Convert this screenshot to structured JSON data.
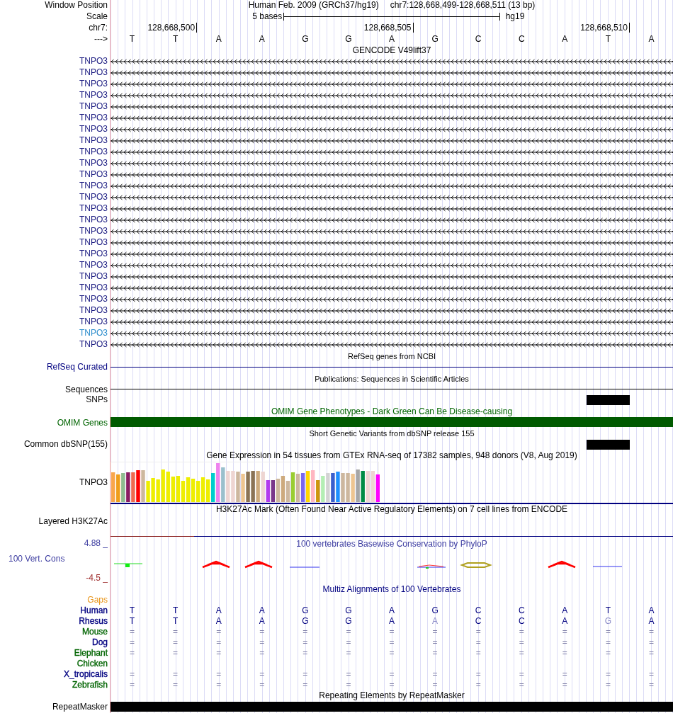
{
  "window_position": {
    "label": "Window Position",
    "assembly": "Human Feb. 2009 (GRCh37/hg19)",
    "range": "chr7:128,668,499-128,668,511 (13 bp)"
  },
  "scale": {
    "label": "Scale",
    "bar_text": "5 bases",
    "assembly": "hg19"
  },
  "ruler": {
    "label": "chr7:",
    "ticks": [
      "128,668,500",
      "128,668,505",
      "128,668,510"
    ]
  },
  "sequence": {
    "label": "--->",
    "bases": [
      "T",
      "T",
      "A",
      "A",
      "G",
      "G",
      "A",
      "G",
      "C",
      "C",
      "A",
      "T",
      "A"
    ]
  },
  "tracks": [
    {
      "kind": "gencode",
      "title": "GENCODE V49lift37",
      "rows": [
        {
          "kind": "gene",
          "label": "TNPO3",
          "highlighted": false
        },
        {
          "kind": "gene",
          "label": "TNPO3",
          "highlighted": false
        },
        {
          "kind": "gene",
          "label": "TNPO3",
          "highlighted": false
        },
        {
          "kind": "gene",
          "label": "TNPO3",
          "highlighted": false
        },
        {
          "kind": "gene",
          "label": "TNPO3",
          "highlighted": false
        },
        {
          "kind": "gene",
          "label": "TNPO3",
          "highlighted": false
        },
        {
          "kind": "gene",
          "label": "TNPO3",
          "highlighted": false
        },
        {
          "kind": "gene",
          "label": "TNPO3",
          "highlighted": false
        },
        {
          "kind": "gene",
          "label": "TNPO3",
          "highlighted": false
        },
        {
          "kind": "gene",
          "label": "TNPO3",
          "highlighted": false
        },
        {
          "kind": "gene",
          "label": "TNPO3",
          "highlighted": false
        },
        {
          "kind": "gene",
          "label": "TNPO3",
          "highlighted": false
        },
        {
          "kind": "gene",
          "label": "TNPO3",
          "highlighted": false
        },
        {
          "kind": "gene",
          "label": "TNPO3",
          "highlighted": false
        },
        {
          "kind": "gene",
          "label": "TNPO3",
          "highlighted": false
        },
        {
          "kind": "gene",
          "label": "TNPO3",
          "highlighted": false
        },
        {
          "kind": "gene",
          "label": "TNPO3",
          "highlighted": false
        },
        {
          "kind": "gene",
          "label": "TNPO3",
          "highlighted": false
        },
        {
          "kind": "gene",
          "label": "TNPO3",
          "highlighted": false
        },
        {
          "kind": "gene",
          "label": "TNPO3",
          "highlighted": false
        },
        {
          "kind": "gene",
          "label": "TNPO3",
          "highlighted": false
        },
        {
          "kind": "gene",
          "label": "TNPO3",
          "highlighted": false
        },
        {
          "kind": "gene",
          "label": "TNPO3",
          "highlighted": false
        },
        {
          "kind": "gene",
          "label": "TNPO3",
          "highlighted": false
        },
        {
          "kind": "gene",
          "label": "TNPO3",
          "highlighted": true
        },
        {
          "kind": "gene",
          "label": "TNPO3",
          "highlighted": false
        }
      ]
    },
    {
      "kind": "refseq",
      "title": "RefSeq genes from NCBI",
      "rows": [
        {
          "kind": "line",
          "label": "RefSeq Curated"
        }
      ]
    },
    {
      "kind": "publications",
      "title": "Publications: Sequences in Scientific Articles",
      "rows": [
        {
          "kind": "line",
          "label": "Sequences"
        },
        {
          "kind": "box",
          "label": "SNPs"
        }
      ]
    },
    {
      "kind": "omim",
      "title": "OMIM Gene Phenotypes - Dark Green Can Be Disease-causing",
      "rows": [
        {
          "kind": "bar",
          "label": "OMIM Genes"
        }
      ]
    },
    {
      "kind": "dbsnp",
      "title": "Short Genetic Variants from dbSNP release 155",
      "rows": [
        {
          "kind": "box",
          "label": "Common dbSNP(155)"
        }
      ]
    },
    {
      "kind": "gtex",
      "title": "Gene Expression in 54 tissues from GTEx RNA-seq of 17382 samples, 948 donors (V8, Aug 2019)",
      "rows": [
        {
          "kind": "expression",
          "label": "TNPO3"
        }
      ]
    },
    {
      "kind": "h3k27ac",
      "title": "H3K27Ac Mark (Often Found Near Active Regulatory Elements) on 7 cell lines from ENCODE",
      "rows": [
        {
          "kind": "signal",
          "label": "Layered H3K27Ac"
        }
      ]
    },
    {
      "kind": "phylop",
      "title": "100 vertebrates Basewise Conservation by PhyloP",
      "rows": [
        {
          "kind": "conservation",
          "label": "100 Vert. Cons",
          "max": "4.88 _",
          "min": "-4.5 _"
        }
      ]
    },
    {
      "kind": "multiz",
      "title": "Multiz Alignments of 100 Vertebrates",
      "rows": [
        {
          "kind": "gaps",
          "label": "Gaps"
        },
        {
          "kind": "bases",
          "label": "Human",
          "color": "#000080",
          "cells": [
            {
              "text": "T",
              "faded": false
            },
            {
              "text": "T",
              "faded": false
            },
            {
              "text": "A",
              "faded": false
            },
            {
              "text": "A",
              "faded": false
            },
            {
              "text": "G",
              "faded": false
            },
            {
              "text": "G",
              "faded": false
            },
            {
              "text": "A",
              "faded": false
            },
            {
              "text": "G",
              "faded": false
            },
            {
              "text": "C",
              "faded": false
            },
            {
              "text": "C",
              "faded": false
            },
            {
              "text": "A",
              "faded": false
            },
            {
              "text": "T",
              "faded": false
            },
            {
              "text": "A",
              "faded": false
            }
          ]
        },
        {
          "kind": "bases",
          "label": "Rhesus",
          "color": "#000080",
          "cells": [
            {
              "text": "T",
              "faded": false
            },
            {
              "text": "T",
              "faded": false
            },
            {
              "text": "A",
              "faded": false
            },
            {
              "text": "A",
              "faded": false
            },
            {
              "text": "G",
              "faded": false
            },
            {
              "text": "G",
              "faded": false
            },
            {
              "text": "A",
              "faded": false
            },
            {
              "text": "A",
              "faded": true
            },
            {
              "text": "C",
              "faded": false
            },
            {
              "text": "C",
              "faded": false
            },
            {
              "text": "A",
              "faded": false
            },
            {
              "text": "G",
              "faded": true
            },
            {
              "text": "A",
              "faded": false
            }
          ]
        },
        {
          "kind": "match",
          "label": "Mouse",
          "color": "#006400",
          "cells": [
            "=",
            "=",
            "=",
            "=",
            "=",
            "=",
            "=",
            "=",
            "=",
            "=",
            "=",
            "=",
            "="
          ]
        },
        {
          "kind": "match",
          "label": "Dog",
          "color": "#000080",
          "cells": [
            "=",
            "=",
            "=",
            "=",
            "=",
            "=",
            "=",
            "=",
            "=",
            "=",
            "=",
            "=",
            "="
          ]
        },
        {
          "kind": "match",
          "label": "Elephant",
          "color": "#006400",
          "cells": [
            "=",
            "=",
            "=",
            "=",
            "=",
            "=",
            "=",
            "=",
            "=",
            "=",
            "=",
            "=",
            "="
          ]
        },
        {
          "kind": "match",
          "label": "Chicken",
          "color": "#006400",
          "cells": []
        },
        {
          "kind": "match",
          "label": "X_tropicalis",
          "color": "#000080",
          "cells": [
            "=",
            "=",
            "=",
            "=",
            "=",
            "=",
            "=",
            "=",
            "=",
            "=",
            "=",
            "=",
            "="
          ]
        },
        {
          "kind": "match",
          "label": "Zebrafish",
          "color": "#006400",
          "cells": [
            "=",
            "=",
            "=",
            "=",
            "=",
            "=",
            "=",
            "=",
            "=",
            "=",
            "=",
            "=",
            "="
          ]
        }
      ]
    },
    {
      "kind": "repeatmasker",
      "title": "Repeating Elements by RepeatMasker",
      "rows": [
        {
          "kind": "bar",
          "label": "RepeatMasker"
        }
      ]
    }
  ]
}
